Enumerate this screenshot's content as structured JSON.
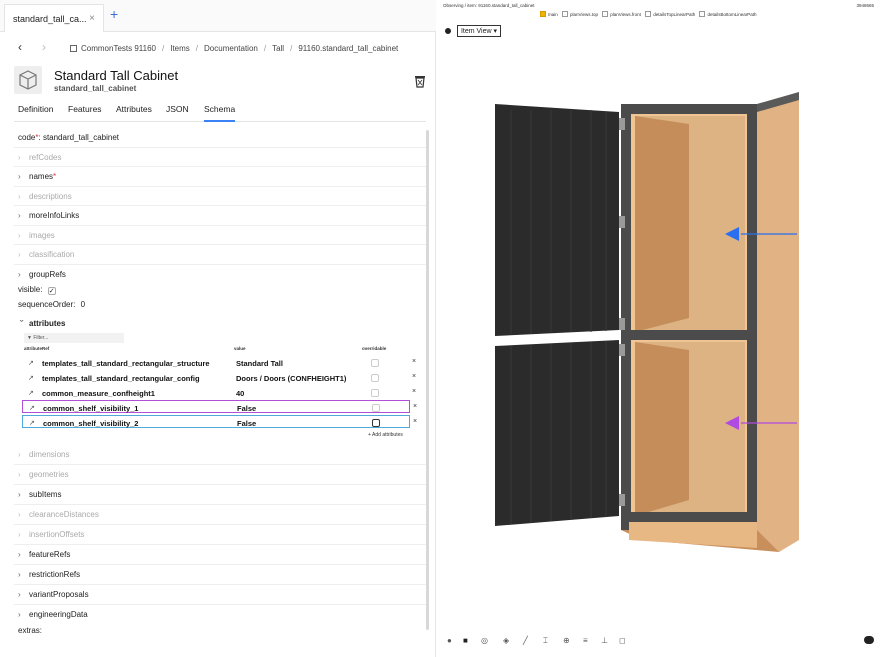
{
  "window_tab": {
    "title": "standard_tall_ca...",
    "close": "×",
    "add": "+"
  },
  "breadcrumb": {
    "back": "‹",
    "forward": "›",
    "items": [
      "CommonTests 91160",
      "Items",
      "Documentation",
      "Tall",
      "91160.standard_tall_cabinet"
    ]
  },
  "item": {
    "title": "Standard Tall Cabinet",
    "code": "standard_tall_cabinet"
  },
  "tabs": [
    "Definition",
    "Features",
    "Attributes",
    "JSON",
    "Schema"
  ],
  "active_tab": "Schema",
  "schema": {
    "code_label": "code",
    "code_required": "*",
    "code_value": "standard_tall_cabinet",
    "rows": [
      {
        "label": "refCodes",
        "dim": true
      },
      {
        "label": "names",
        "required": "*",
        "dim": false
      },
      {
        "label": "descriptions",
        "dim": true
      },
      {
        "label": "moreInfoLinks",
        "dim": false
      },
      {
        "label": "images",
        "dim": true
      },
      {
        "label": "classification",
        "dim": true
      },
      {
        "label": "groupRefs",
        "dim": false
      }
    ],
    "visible_label": "visible:",
    "visible_check": "✓",
    "sequence_label": "sequenceOrder:",
    "sequence_value": "0",
    "attributes_label": "attributes",
    "filter_placeholder": "Filter...",
    "attr_columns": [
      "attributeRef",
      "value",
      "overridable"
    ],
    "attr_rows": [
      {
        "name": "templates_tall_standard_rectangular_structure",
        "value": "Standard Tall"
      },
      {
        "name": "templates_tall_standard_rectangular_config",
        "value": "Doors / Doors (CONFHEIGHT1)"
      },
      {
        "name": "common_measure_confheight1",
        "value": "40"
      },
      {
        "name": "common_shelf_visibility_1",
        "value": "False"
      },
      {
        "name": "common_shelf_visibility_2",
        "value": "False"
      }
    ],
    "delete_glyph": "×",
    "ext_glyph": "↗",
    "add_attributes": "+ Add attributes",
    "rows_after": [
      {
        "label": "dimensions",
        "dim": true
      },
      {
        "label": "geometries",
        "dim": true
      },
      {
        "label": "subItems",
        "dim": false
      },
      {
        "label": "clearanceDistances",
        "dim": true
      },
      {
        "label": "insertionOffsets",
        "dim": true
      },
      {
        "label": "featureRefs",
        "dim": false
      },
      {
        "label": "restrictionRefs",
        "dim": false
      },
      {
        "label": "variantProposals",
        "dim": false
      },
      {
        "label": "engineeringData",
        "dim": false
      }
    ],
    "extras_label": "extras:"
  },
  "viewer": {
    "observing": "Observing / item: 91160.standard_tall_cabinet",
    "build": "3948665",
    "views": [
      {
        "label": "main",
        "checked": true
      },
      {
        "label": "planViews.top",
        "checked": false
      },
      {
        "label": "planViews.front",
        "checked": false
      },
      {
        "label": "detailsTopLinearPath",
        "checked": false
      },
      {
        "label": "detailsBottomLinearPath",
        "checked": false
      }
    ],
    "view_select": "Item View",
    "select_arrow": "▾",
    "colors": {
      "carcass": "#d9a877",
      "door": "#2b2b2b",
      "frame": "#555555",
      "arrow_blue": "#2a6ff0",
      "arrow_purple": "#b04ae0"
    }
  }
}
